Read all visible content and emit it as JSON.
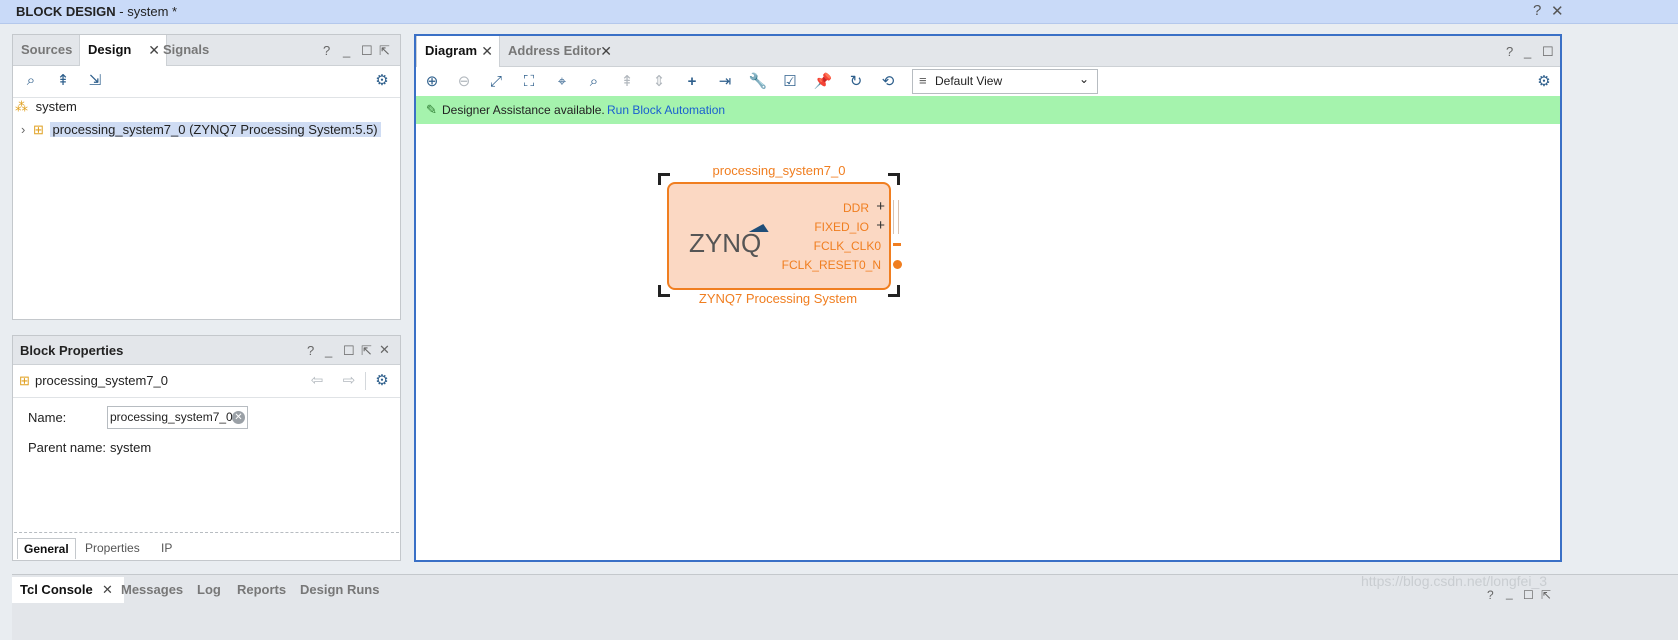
{
  "titlebar": {
    "title_bold": "BLOCK DESIGN",
    "title_rest": " - system *",
    "help": "?",
    "close": "✕"
  },
  "left_panel": {
    "tabs": [
      {
        "label": "Sources"
      },
      {
        "label": "Design",
        "active": true
      },
      {
        "label": "Signals"
      }
    ],
    "tab_close": "✕",
    "tree": {
      "root": "system",
      "child": "processing_system7_0 (ZYNQ7 Processing System:5.5)"
    }
  },
  "block_properties": {
    "title": "Block Properties",
    "object": "processing_system7_0",
    "name_label": "Name:",
    "name_value": "processing_system7_0",
    "parent_label": "Parent name:",
    "parent_value": "system",
    "tabs": [
      "General",
      "Properties",
      "IP"
    ]
  },
  "diagram_panel": {
    "tabs": [
      {
        "label": "Diagram",
        "active": true
      },
      {
        "label": "Address Editor"
      }
    ],
    "view_select": "Default View",
    "assist_text": "Designer Assistance available.",
    "assist_link": "Run Block Automation",
    "block": {
      "instance_name": "processing_system7_0",
      "type_name": "ZYNQ7 Processing System",
      "logo": "ZYNQ",
      "ports": [
        "DDR",
        "FIXED_IO",
        "FCLK_CLK0",
        "FCLK_RESET0_N"
      ]
    }
  },
  "bottom_tabs": [
    "Tcl Console",
    "Messages",
    "Log",
    "Reports",
    "Design Runs"
  ],
  "watermark": "https://blog.csdn.net/longfei_3",
  "colors": {
    "accent": "#3a70c6",
    "block_orange": "#f07e20",
    "block_fill": "#fbd8c3",
    "assist_green": "#a5f3ad",
    "link": "#1a5fd0"
  }
}
